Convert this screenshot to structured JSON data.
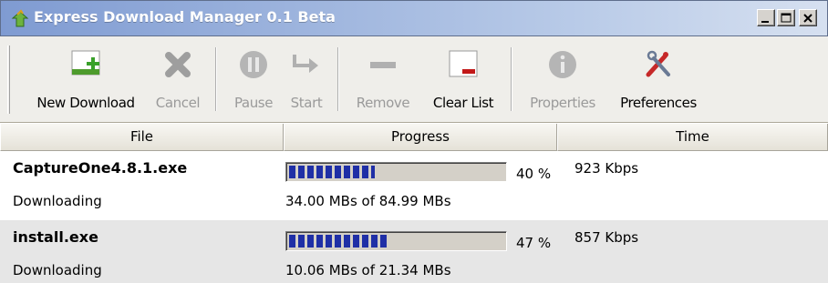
{
  "window": {
    "title": "Express Download Manager 0.1 Beta"
  },
  "toolbar": {
    "buttons": [
      {
        "label": "New Download",
        "icon": "new-download-icon",
        "enabled": true
      },
      {
        "label": "Cancel",
        "icon": "cancel-x-icon",
        "enabled": false
      },
      {
        "label": "Pause",
        "icon": "pause-icon",
        "enabled": false
      },
      {
        "label": "Start",
        "icon": "start-arrow-icon",
        "enabled": false
      },
      {
        "label": "Remove",
        "icon": "remove-minus-icon",
        "enabled": false
      },
      {
        "label": "Clear List",
        "icon": "clear-list-icon",
        "enabled": true
      },
      {
        "label": "Properties",
        "icon": "info-icon",
        "enabled": false
      },
      {
        "label": "Preferences",
        "icon": "tools-icon",
        "enabled": true
      }
    ]
  },
  "table": {
    "columns": [
      "File",
      "Progress",
      "Time"
    ],
    "rows": [
      {
        "file": "CaptureOne4.8.1.exe",
        "status": "Downloading",
        "progress": 0.4,
        "percent": "40 %",
        "size": "34.00 MBs of 84.99 MBs",
        "speed": "923 Kbps"
      },
      {
        "file": "install.exe",
        "status": "Downloading",
        "progress": 0.47,
        "percent": "47 %",
        "size": "10.06 MBs of 21.34 MBs",
        "speed": "857 Kbps"
      }
    ]
  },
  "colors": {
    "progress_fill": "#1f2fa6",
    "title_gradient_start": "#7f9bd2"
  }
}
